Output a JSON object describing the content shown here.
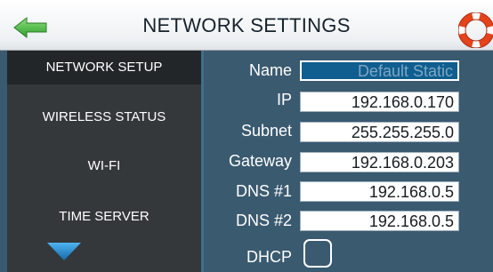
{
  "header": {
    "title": "NETWORK SETTINGS",
    "back_icon": "back-arrow-icon",
    "help_icon": "lifebuoy-help-icon"
  },
  "sidebar": {
    "items": [
      {
        "label": "NETWORK SETUP",
        "active": true
      },
      {
        "label": "WIRELESS STATUS",
        "active": false
      },
      {
        "label": "WI-FI",
        "active": false
      },
      {
        "label": "TIME SERVER",
        "active": false
      }
    ],
    "scroll_icon": "scroll-down-triangle-icon"
  },
  "form": {
    "name": {
      "label": "Name",
      "value": "Default Static"
    },
    "ip": {
      "label": "IP",
      "value": "192.168.0.170"
    },
    "subnet": {
      "label": "Subnet",
      "value": "255.255.255.0"
    },
    "gateway": {
      "label": "Gateway",
      "value": "192.168.0.203"
    },
    "dns1": {
      "label": "DNS #1",
      "value": "192.168.0.5"
    },
    "dns2": {
      "label": "DNS #2",
      "value": "192.168.0.5"
    },
    "dhcp": {
      "label": "DHCP",
      "checked": false
    }
  },
  "colors": {
    "header_bg": "#ffffff",
    "sidebar_bg": "#34383b",
    "sidebar_active_bg": "#232628",
    "form_bg": "#3a5a70",
    "accent_blue": "#1e7fc4",
    "selected_field_bg": "#0f5e8f",
    "back_arrow": "#3cae3a",
    "help_red": "#e5431b"
  }
}
